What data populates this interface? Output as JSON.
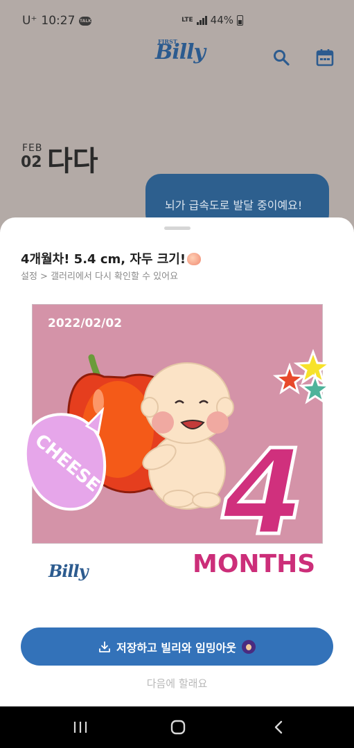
{
  "status_bar": {
    "carrier": "U⁺",
    "time": "10:27",
    "talk_icon_text": "TALK",
    "network": "LTE",
    "battery": "44%"
  },
  "header": {
    "logo_small": "FIRST",
    "logo": "Billy",
    "icons": [
      "search-icon",
      "calendar-icon"
    ]
  },
  "date": {
    "month": "FEB",
    "day": "02",
    "baby_name": "다다"
  },
  "speech_bubble": "뇌가 급속도로 발달 중이예요!",
  "sheet": {
    "title": "4개월차! 5.4 cm, 자두 크기!",
    "subtitle": "설정 > 갤러리에서 다시 확인할 수 있어요",
    "card": {
      "date": "2022/02/02",
      "bubble_text": "CHEESE",
      "number": "4",
      "months_label": "MONTHS",
      "brand": "Billy",
      "background": "#d493a8"
    },
    "save_button": "저장하고 빌리와 임밍아웃",
    "later_link": "다음에 할래요"
  },
  "nav_bar": {
    "buttons": [
      "recent-apps",
      "home",
      "back"
    ]
  },
  "colors": {
    "primary": "#3372b9",
    "bubble": "#2d5f8e",
    "months": "#cc2e79"
  }
}
